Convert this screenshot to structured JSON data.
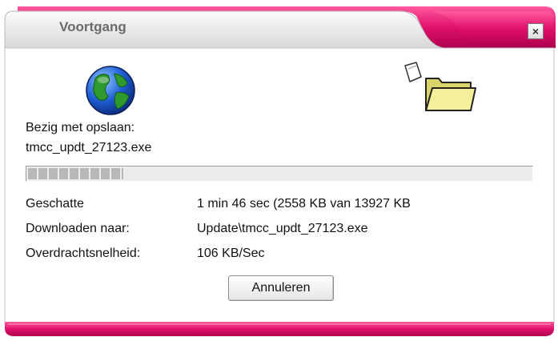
{
  "window": {
    "title": "Voortgang",
    "close_symbol": "×",
    "accent_color": "#e0106a"
  },
  "status": {
    "line1": "Bezig met opslaan:",
    "filename": "tmcc_updt_27123.exe"
  },
  "progress": {
    "fraction": 0.19
  },
  "details": {
    "estimated_label": "Geschatte",
    "estimated_value": "1 min 46 sec (2558 KB van 13927 KB",
    "download_to_label": "Downloaden naar:",
    "download_to_value": "Update\\tmcc_updt_27123.exe",
    "rate_label": "Overdrachtsnelheid:",
    "rate_value": "106 KB/Sec"
  },
  "buttons": {
    "cancel_label": "Annuleren"
  },
  "icons": {
    "globe": "globe-icon",
    "folder": "folder-icon"
  }
}
